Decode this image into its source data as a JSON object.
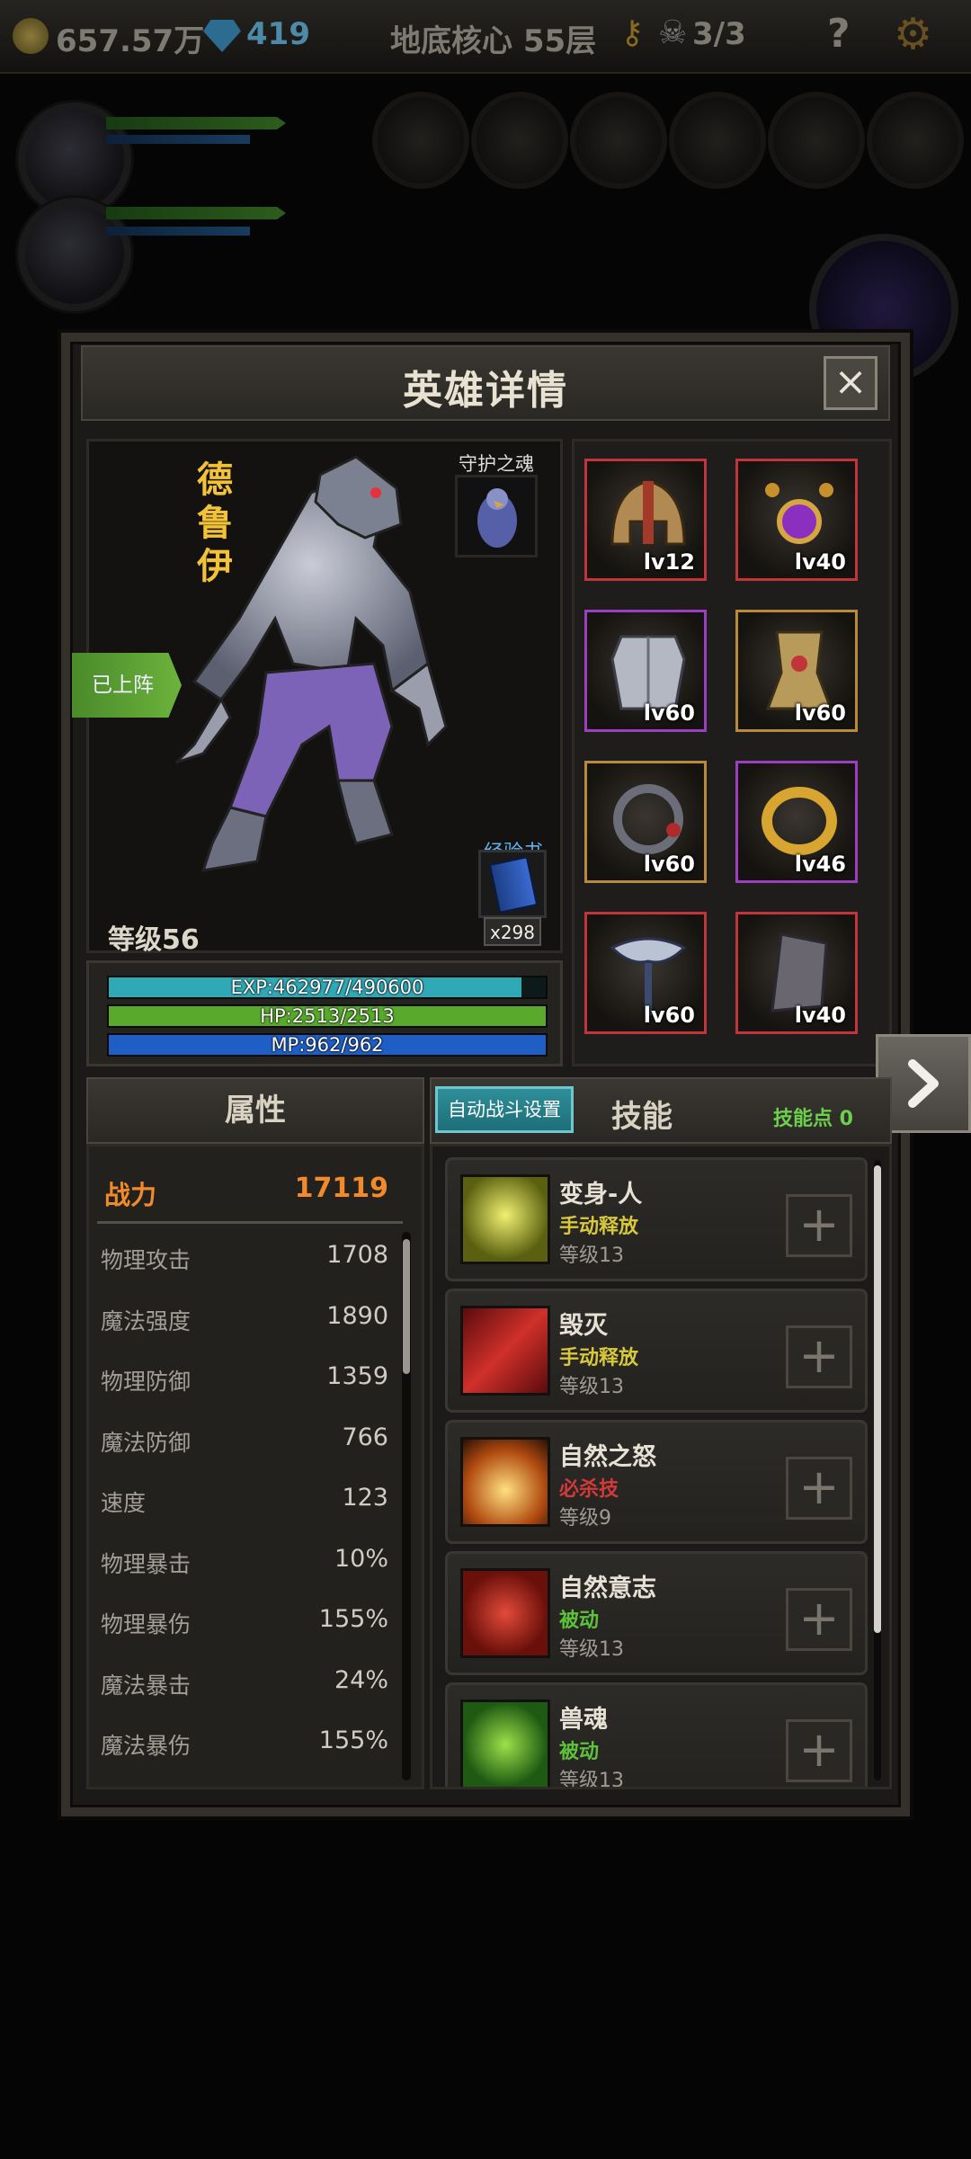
{
  "topbar": {
    "gold": "657.57万",
    "gems": "419",
    "location": "地底核心 55层",
    "skull_count": "3/3",
    "help": "?"
  },
  "panel": {
    "title": "英雄详情",
    "close_icon": "close-icon"
  },
  "hero": {
    "name_chars": [
      "德",
      "鲁",
      "伊"
    ],
    "soul_label": "守护之魂",
    "deployed": "已上阵",
    "expbook_label": "经验书",
    "expbook_count": "x298",
    "level": "等级56",
    "bars": {
      "exp": {
        "text": "EXP:462977/490600",
        "fill": 0.944,
        "color": "#2fa9b6"
      },
      "hp": {
        "text": "HP:2513/2513",
        "fill": 1.0,
        "color": "#58a92c"
      },
      "mp": {
        "text": "MP:962/962",
        "fill": 1.0,
        "color": "#1f5ec4"
      }
    }
  },
  "equipment": [
    {
      "name": "helmet",
      "level": "lv12",
      "border": "#c0343a"
    },
    {
      "name": "amulet",
      "level": "lv40",
      "border": "#c0343a"
    },
    {
      "name": "chest-armor",
      "level": "lv60",
      "border": "#9b3fc0"
    },
    {
      "name": "leg-armor",
      "level": "lv60",
      "border": "#b88a3a"
    },
    {
      "name": "bracelet",
      "level": "lv60",
      "border": "#b88a3a"
    },
    {
      "name": "ring",
      "level": "lv46",
      "border": "#9b3fc0"
    },
    {
      "name": "axe",
      "level": "lv60",
      "border": "#c0343a"
    },
    {
      "name": "shield",
      "level": "lv40",
      "border": "#c0343a"
    }
  ],
  "attributes": {
    "tab": "属性",
    "power_label": "战力",
    "power_value": "17119",
    "items": [
      {
        "name": "物理攻击",
        "value": "1708"
      },
      {
        "name": "魔法强度",
        "value": "1890"
      },
      {
        "name": "物理防御",
        "value": "1359"
      },
      {
        "name": "魔法防御",
        "value": "766"
      },
      {
        "name": "速度",
        "value": "123"
      },
      {
        "name": "物理暴击",
        "value": "10%"
      },
      {
        "name": "物理暴伤",
        "value": "155%"
      },
      {
        "name": "魔法暴击",
        "value": "24%"
      },
      {
        "name": "魔法暴伤",
        "value": "155%"
      }
    ]
  },
  "skills": {
    "auto_button": "自动战斗设置",
    "tab": "技能",
    "points": "技能点 0",
    "items": [
      {
        "name": "变身-人",
        "type": "手动释放",
        "type_color": "#d7c83c",
        "level": "等级13"
      },
      {
        "name": "毁灭",
        "type": "手动释放",
        "type_color": "#d7c83c",
        "level": "等级13"
      },
      {
        "name": "自然之怒",
        "type": "必杀技",
        "type_color": "#d23a3a",
        "level": "等级9"
      },
      {
        "name": "自然意志",
        "type": "被动",
        "type_color": "#5cc23a",
        "level": "等级13"
      },
      {
        "name": "兽魂",
        "type": "被动",
        "type_color": "#5cc23a",
        "level": "等级13"
      }
    ]
  }
}
